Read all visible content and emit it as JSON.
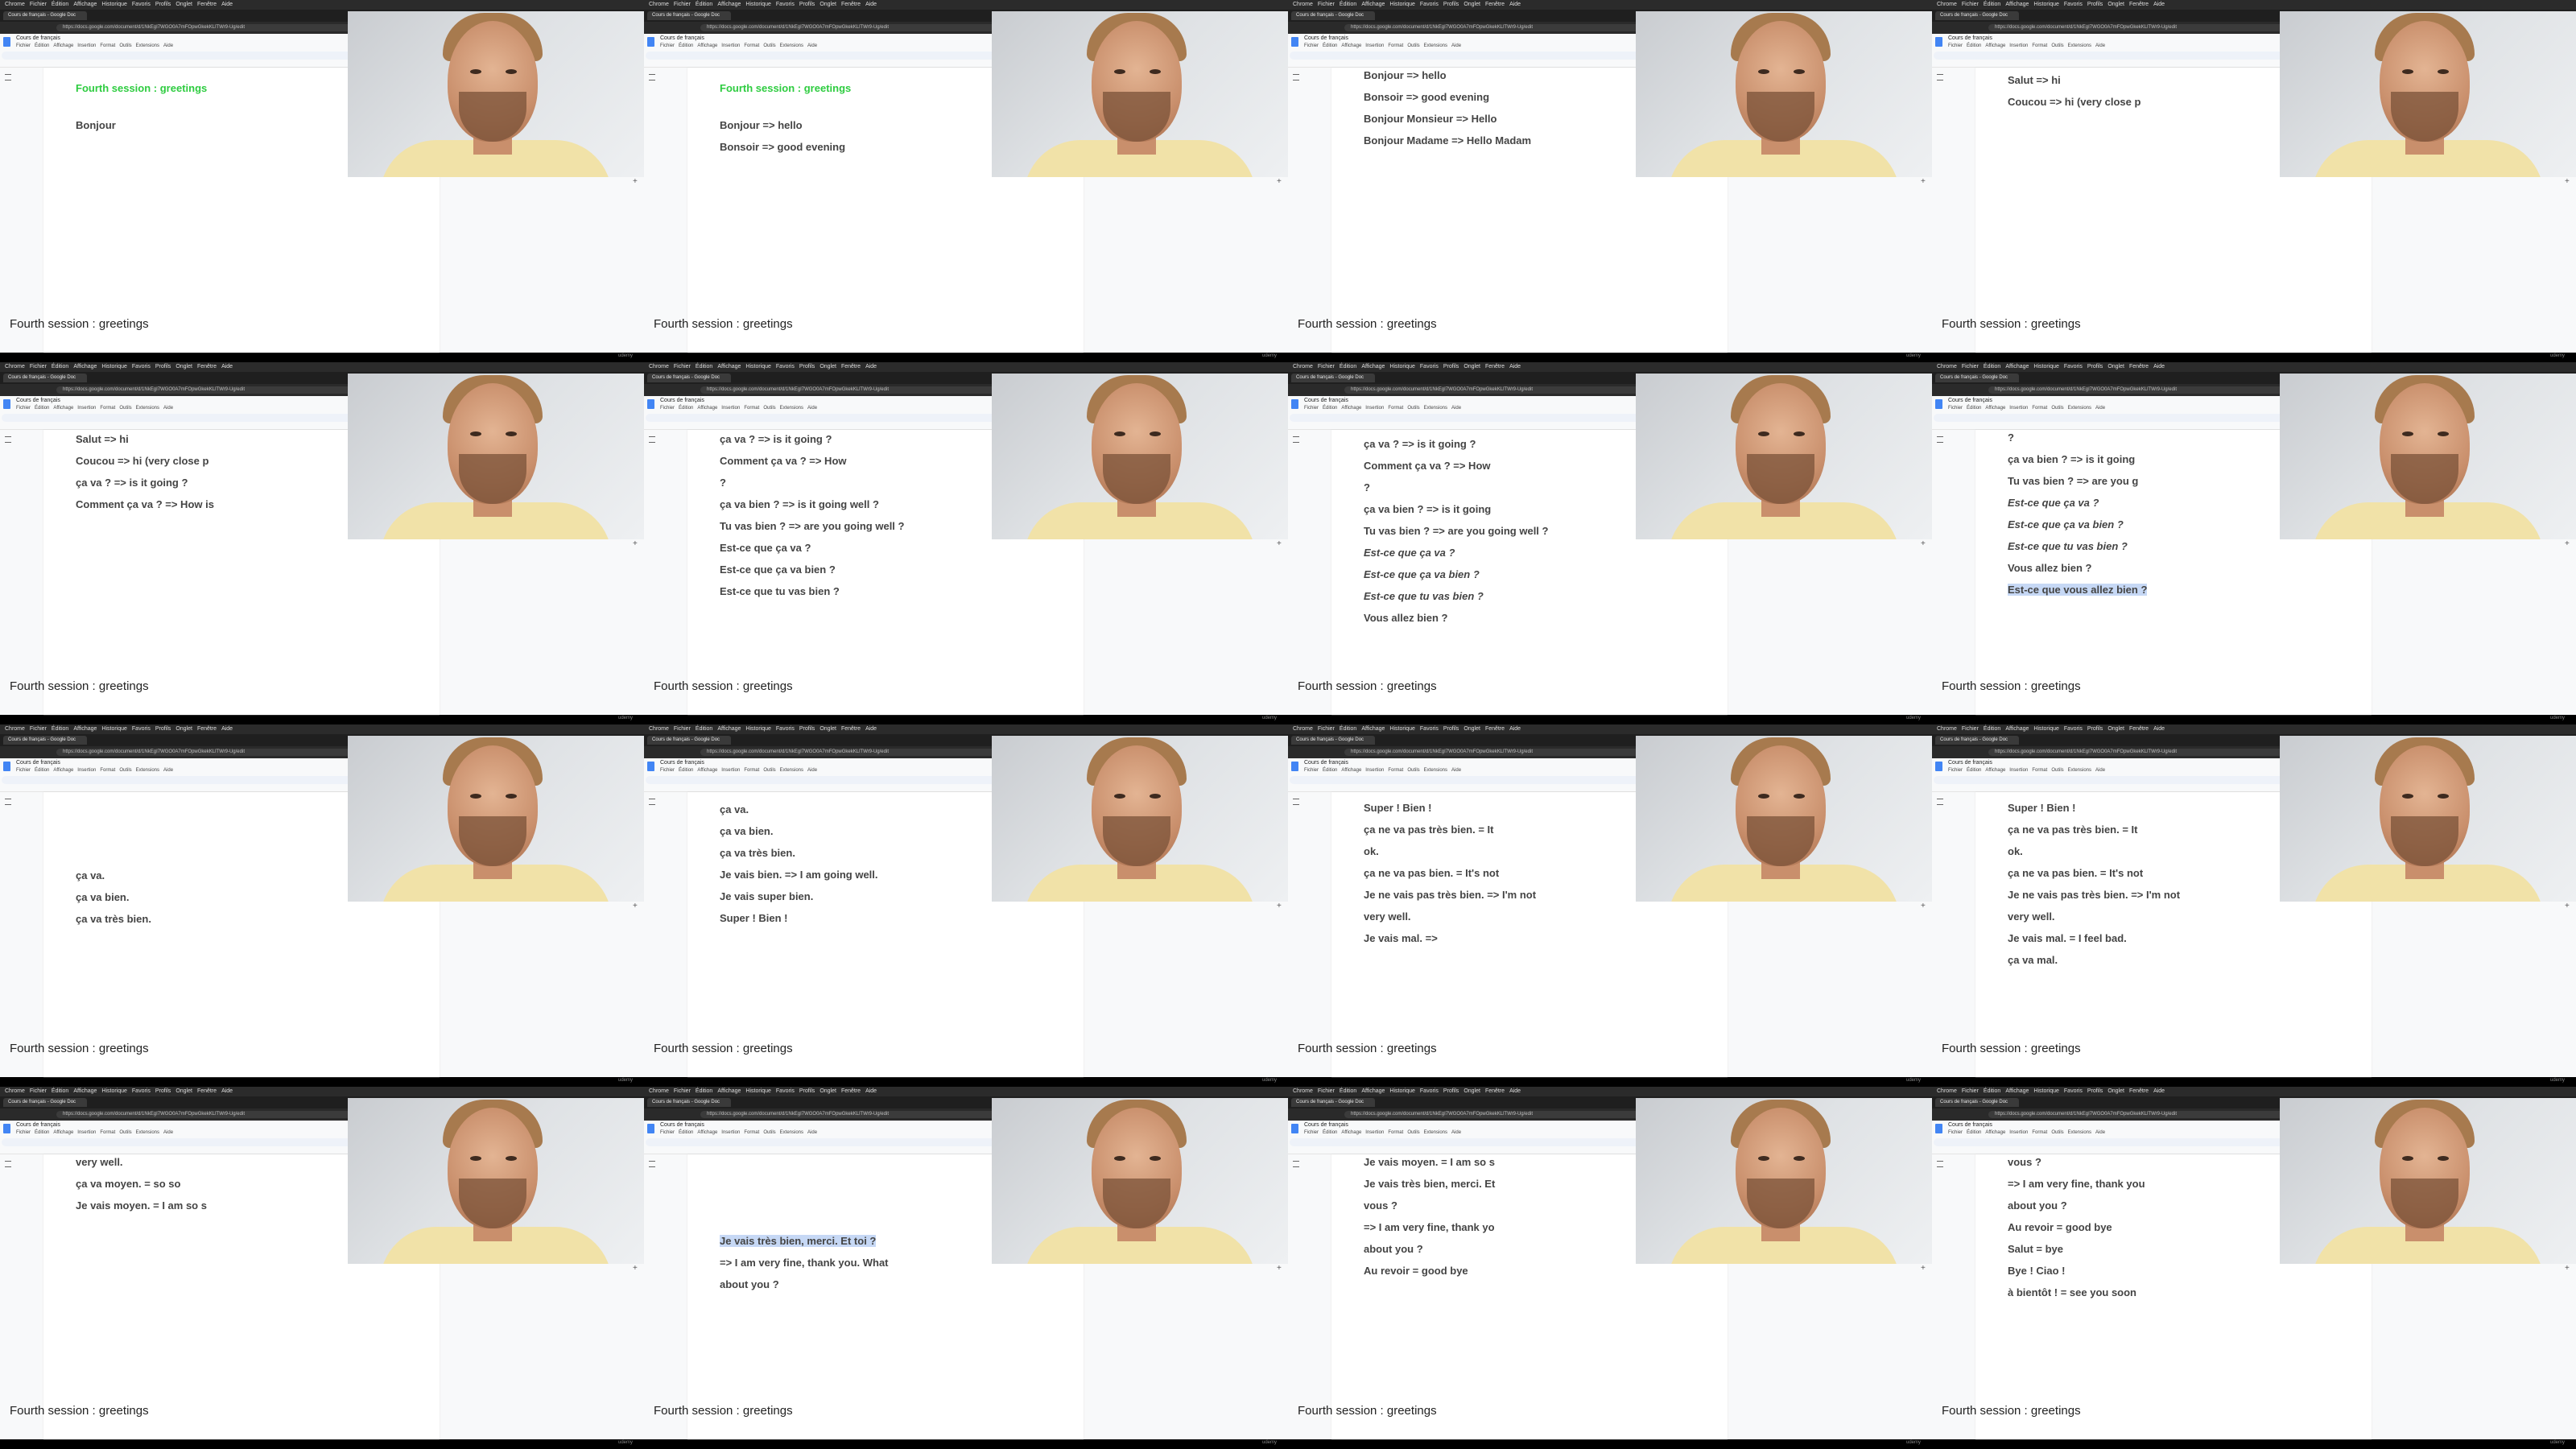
{
  "browser": {
    "menu_items": [
      "Chrome",
      "Fichier",
      "Édition",
      "Affichage",
      "Historique",
      "Favoris",
      "Profils",
      "Onglet",
      "Fenêtre",
      "Aide"
    ],
    "tab_title": "Cours de français - Google Doc",
    "url": "https://docs.google.com/document/d/1NkEgI7WGO0A7mFOpwGkekKLlTWr9-Ug/edit"
  },
  "doc": {
    "title": "Cours de français",
    "menu": [
      "Fichier",
      "Édition",
      "Affichage",
      "Insertion",
      "Format",
      "Outils",
      "Extensions",
      "Aide"
    ],
    "outline_title": "Fourth session : greetings"
  },
  "frames": [
    {
      "lines": [
        {
          "t": "Fourth session : greetings",
          "green": true
        },
        {
          "t": "Bonjour"
        }
      ]
    },
    {
      "lines": [
        {
          "t": "Fourth session : greetings",
          "green": true
        },
        {
          "t": "Bonjour => hello"
        },
        {
          "t": "Bonsoir => good evening"
        }
      ]
    },
    {
      "lines": [
        {
          "t": "Bonjour => hello"
        },
        {
          "t": "Bonsoir => good evening"
        },
        {
          "t": "Bonjour Monsieur => Hello"
        },
        {
          "t": "Bonjour Madame => Hello Madam"
        }
      ]
    },
    {
      "lines": [
        {
          "t": "Salut => hi"
        },
        {
          "t": "Coucou => hi (very close p"
        }
      ]
    },
    {
      "lines": [
        {
          "t": "Salut => hi"
        },
        {
          "t": "Coucou => hi (very close p"
        },
        {
          "t": "ça va ? => is it going ?"
        },
        {
          "t": "Comment ça va ? => How is"
        }
      ]
    },
    {
      "lines": [
        {
          "t": "ça va ? => is it going ?"
        },
        {
          "t": "Comment ça va ? => How"
        },
        {
          "t": "?"
        },
        {
          "t": "ça va bien ? => is it going well ?"
        },
        {
          "t": "Tu vas bien ? => are you going well ?"
        },
        {
          "t": "Est-ce que ça va ?"
        },
        {
          "t": "Est-ce que ça va bien ?"
        },
        {
          "t": "Est-ce que tu vas bien ?"
        }
      ]
    },
    {
      "lines": [
        {
          "t": "ça va ? => is it going ?"
        },
        {
          "t": "Comment ça va ? => How"
        },
        {
          "t": "?"
        },
        {
          "t": "ça va bien ? => is it going"
        },
        {
          "t": "Tu vas bien ? => are you going well ?"
        },
        {
          "t": "Est-ce que ça va ?",
          "i": true
        },
        {
          "t": "Est-ce que ça va bien ?",
          "i": true
        },
        {
          "t": "Est-ce que tu vas bien ?",
          "i": true
        },
        {
          "t": "Vous allez bien ?"
        }
      ]
    },
    {
      "lines": [
        {
          "t": "?"
        },
        {
          "t": "ça va bien ? => is it going"
        },
        {
          "t": "Tu vas bien ? => are you g"
        },
        {
          "t": "Est-ce que ça va ?",
          "i": true
        },
        {
          "t": "Est-ce que ça va bien ?",
          "i": true
        },
        {
          "t": "Est-ce que tu vas bien ?",
          "i": true
        },
        {
          "t": "Vous allez bien ?"
        },
        {
          "t": "Est-ce que vous allez bien ?",
          "hl": true
        }
      ]
    },
    {
      "lines": [
        {
          "t": "ça va."
        },
        {
          "t": "ça va bien."
        },
        {
          "t": "ça va très bien."
        }
      ]
    },
    {
      "lines": [
        {
          "t": "ça va."
        },
        {
          "t": "ça va bien."
        },
        {
          "t": "ça va très bien."
        },
        {
          "t": "Je vais bien. => I am going well."
        },
        {
          "t": "Je vais super bien."
        },
        {
          "t": "Super ! Bien !"
        }
      ]
    },
    {
      "lines": [
        {
          "t": "Super ! Bien !"
        },
        {
          "t": "ça ne va pas très bien. = It"
        },
        {
          "t": "ok."
        },
        {
          "t": "ça ne va pas bien. = It's not"
        },
        {
          "t": "Je ne vais pas très bien. => I'm not"
        },
        {
          "t": "very well."
        },
        {
          "t": "Je vais mal. =>"
        }
      ]
    },
    {
      "lines": [
        {
          "t": "Super ! Bien !"
        },
        {
          "t": "ça ne va pas très bien. = It"
        },
        {
          "t": "ok."
        },
        {
          "t": "ça ne va pas bien. = It's not"
        },
        {
          "t": "Je ne vais pas très bien. => I'm not"
        },
        {
          "t": "very well."
        },
        {
          "t": "Je vais mal. = I feel bad."
        },
        {
          "t": "ça va mal."
        }
      ]
    },
    {
      "lines": [
        {
          "t": "very well."
        },
        {
          "t": "ça va moyen. = so so"
        },
        {
          "t": "Je vais moyen. = I am so s"
        }
      ]
    },
    {
      "lines": [
        {
          "t": "Je vais très bien, merci. Et toi ?",
          "hl": true
        },
        {
          "t": "=> I am very fine, thank you. What"
        },
        {
          "t": "about you ?"
        }
      ]
    },
    {
      "lines": [
        {
          "t": "Je vais moyen. = I am so s"
        },
        {
          "t": "Je vais très bien, merci. Et"
        },
        {
          "t": "vous ?"
        },
        {
          "t": "=> I am very fine, thank yo"
        },
        {
          "t": "about you ?"
        },
        {
          "t": "Au revoir = good bye"
        }
      ]
    },
    {
      "lines": [
        {
          "t": "vous ?"
        },
        {
          "t": "=> I am very fine, thank you"
        },
        {
          "t": "about you ?"
        },
        {
          "t": "Au revoir = good bye"
        },
        {
          "t": "Salut = bye"
        },
        {
          "t": "Bye ! Ciao !"
        },
        {
          "t": "à bientôt ! = see you soon"
        }
      ]
    }
  ],
  "brand": "udemy"
}
